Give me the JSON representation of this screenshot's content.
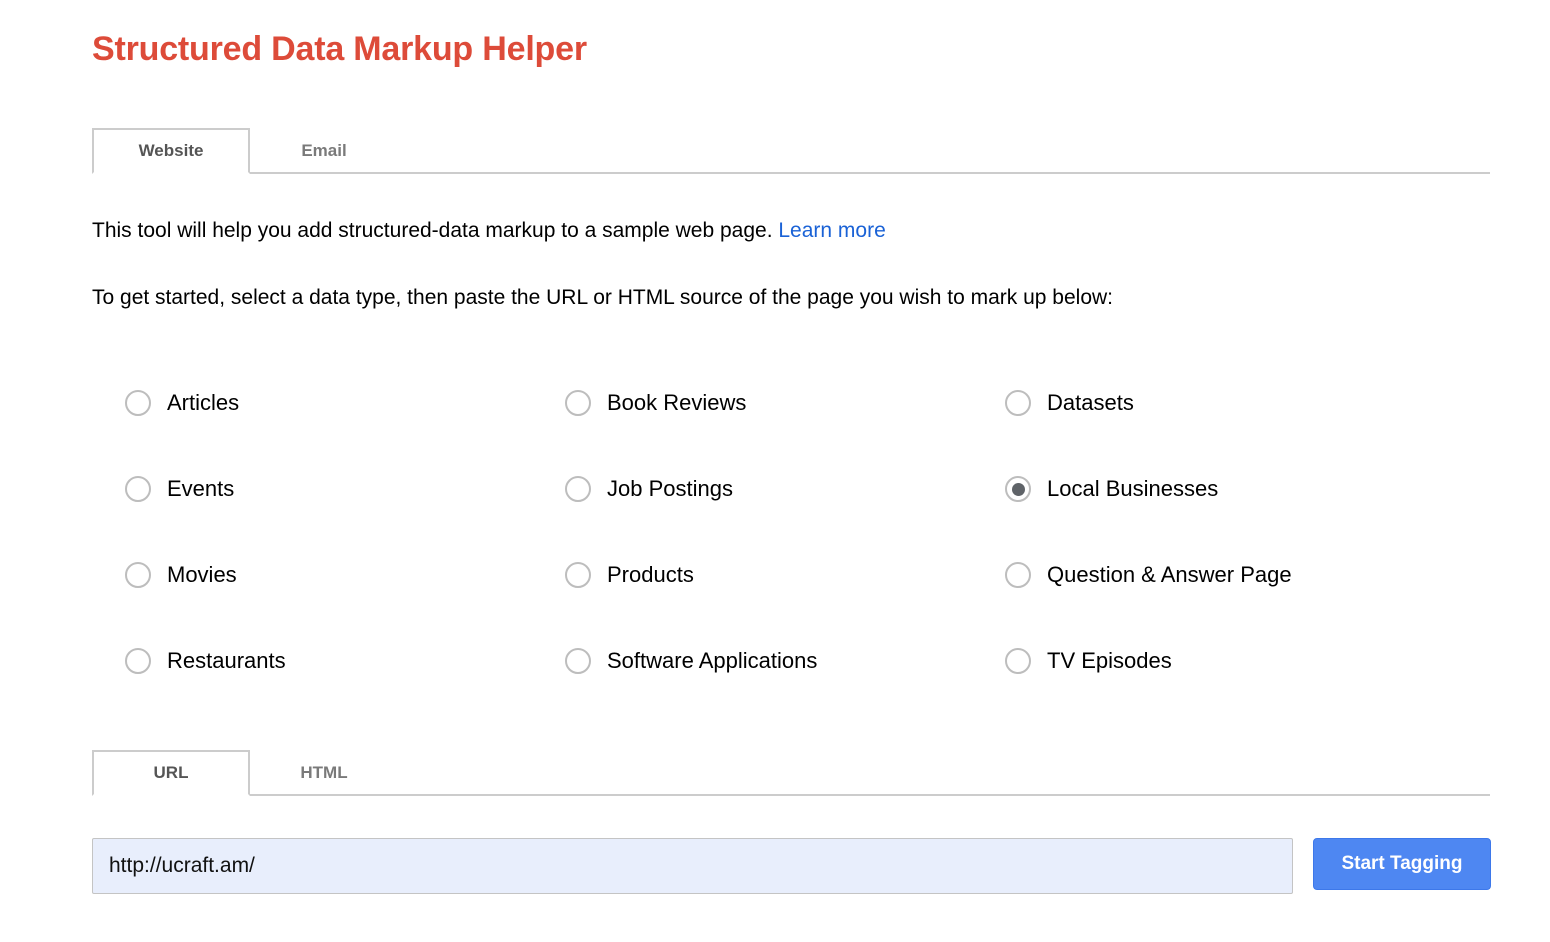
{
  "app": {
    "title": "Structured Data Markup Helper",
    "title_color": "#dd4b39"
  },
  "main_tabs": {
    "items": [
      {
        "label": "Website",
        "active": true
      },
      {
        "label": "Email",
        "active": false
      }
    ]
  },
  "intro": {
    "text": "This tool will help you add structured-data markup to a sample web page.",
    "link_label": "Learn more",
    "link_color": "#1a62d6"
  },
  "instruction": {
    "text": "To get started, select a data type, then paste the URL or HTML source of the page you wish to mark up below:"
  },
  "data_types": {
    "selected": "Local Businesses",
    "columns": [
      {
        "items": [
          {
            "label": "Articles",
            "checked": false
          },
          {
            "label": "Events",
            "checked": false
          },
          {
            "label": "Movies",
            "checked": false
          },
          {
            "label": "Restaurants",
            "checked": false
          }
        ]
      },
      {
        "items": [
          {
            "label": "Book Reviews",
            "checked": false
          },
          {
            "label": "Job Postings",
            "checked": false
          },
          {
            "label": "Products",
            "checked": false
          },
          {
            "label": "Software Applications",
            "checked": false
          }
        ]
      },
      {
        "items": [
          {
            "label": "Datasets",
            "checked": false
          },
          {
            "label": "Local Businesses",
            "checked": true
          },
          {
            "label": "Question & Answer Page",
            "checked": false
          },
          {
            "label": "TV Episodes",
            "checked": false
          }
        ]
      }
    ]
  },
  "source_tabs": {
    "items": [
      {
        "label": "URL",
        "active": true
      },
      {
        "label": "HTML",
        "active": false
      }
    ]
  },
  "url_field": {
    "value": "http://ucraft.am/",
    "placeholder": "",
    "background_color": "#e8eefc"
  },
  "start_button": {
    "label": "Start Tagging",
    "color": "#4e87f2"
  }
}
